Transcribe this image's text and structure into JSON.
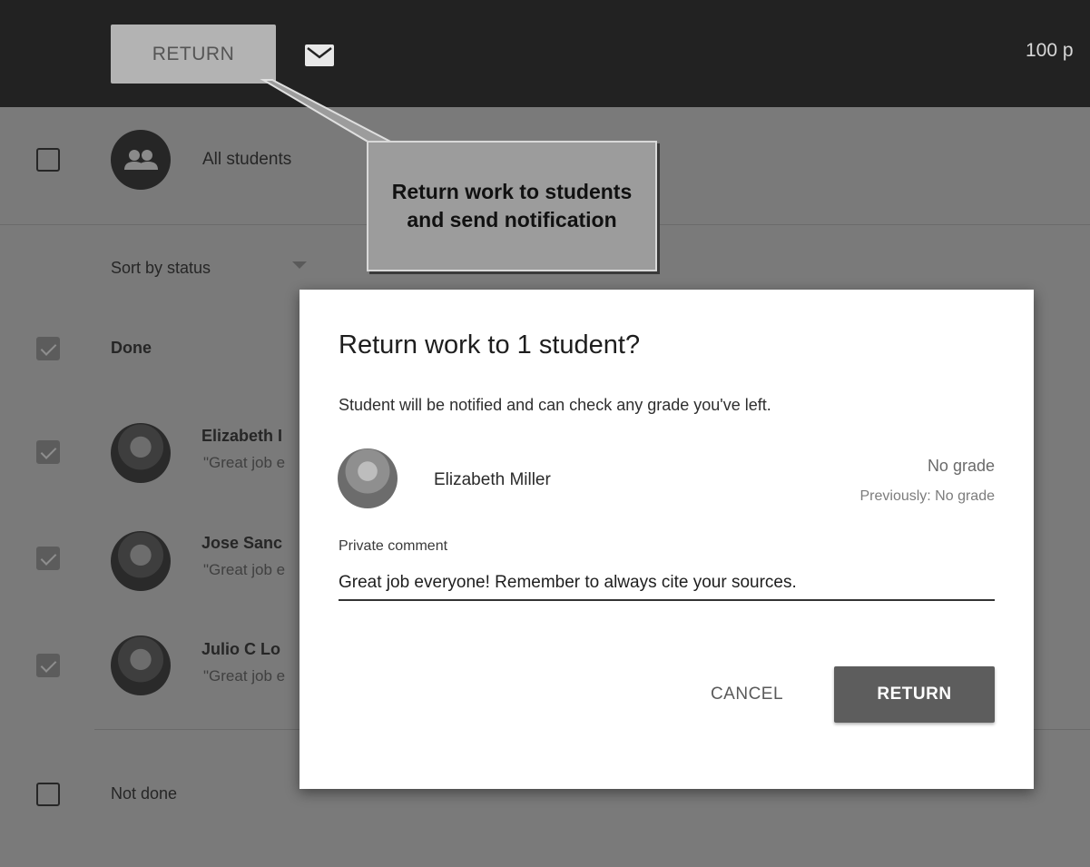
{
  "toolbar": {
    "return_label": "RETURN",
    "points_text": "100 p"
  },
  "list": {
    "all_students_label": "All students",
    "sort_label": "Sort by status",
    "done_label": "Done",
    "not_done_label": "Not done",
    "students": [
      {
        "name": "Elizabeth I",
        "comment": "\"Great job e",
        "checked": true
      },
      {
        "name": "Jose Sanc",
        "comment": "\"Great job e",
        "checked": true
      },
      {
        "name": "Julio C Lo",
        "comment": "\"Great job e",
        "checked": true
      }
    ]
  },
  "callout": {
    "text": "Return work to students and send notification"
  },
  "dialog": {
    "title": "Return work to 1 student?",
    "description": "Student will be notified and can check any grade you've left.",
    "student_name": "Elizabeth Miller",
    "grade": "No grade",
    "previous_grade": "Previously: No grade",
    "comment_label": "Private comment",
    "comment_value": "Great job everyone! Remember to always cite your sources.",
    "cancel_label": "CANCEL",
    "return_label": "RETURN"
  },
  "icons": {
    "mail": "mail-icon",
    "group": "group-icon",
    "sort": "dropdown-arrow-icon"
  },
  "colors": {
    "topbar": "#222222",
    "overlay": "#7a7a7a",
    "primary_button": "#5d5d5d"
  }
}
